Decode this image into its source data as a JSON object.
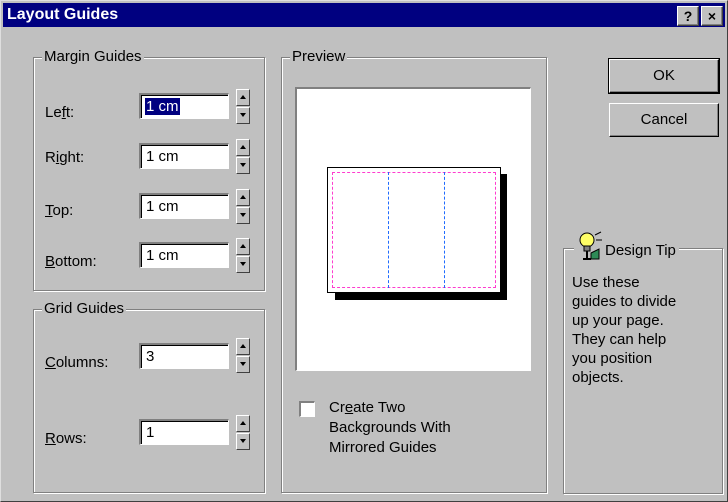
{
  "window": {
    "title": "Layout Guides",
    "help_label": "?",
    "close_label": "×"
  },
  "margin_guides": {
    "title": "Margin Guides",
    "left": {
      "label_pre": "Le",
      "label_u": "f",
      "label_post": "t:",
      "value": "1 cm"
    },
    "right": {
      "label_pre": "R",
      "label_u": "i",
      "label_post": "ght:",
      "value": "1 cm"
    },
    "top": {
      "label_pre": "",
      "label_u": "T",
      "label_post": "op:",
      "value": "1 cm"
    },
    "bottom": {
      "label_pre": "",
      "label_u": "B",
      "label_post": "ottom:",
      "value": "1 cm"
    }
  },
  "grid_guides": {
    "title": "Grid Guides",
    "columns": {
      "label_pre": "",
      "label_u": "C",
      "label_post": "olumns:",
      "value": "3"
    },
    "rows": {
      "label_pre": "",
      "label_u": "R",
      "label_post": "ows:",
      "value": "1"
    }
  },
  "preview": {
    "title": "Preview",
    "checkbox": {
      "checked": false,
      "label_line1_pre": "Cr",
      "label_line1_u": "e",
      "label_line1_post": "ate Two",
      "label_line2": "Backgrounds With",
      "label_line3": "Mirrored Guides"
    },
    "margin_color": "#ff3ccf",
    "guide_color": "#1f6bff"
  },
  "buttons": {
    "ok": "OK",
    "cancel": "Cancel"
  },
  "design_tip": {
    "title": "Design Tip",
    "icon": "light-bulb-icon",
    "text_lines": [
      "Use these",
      "guides to divide",
      "up your page.",
      "They can help",
      "you position",
      "objects."
    ]
  },
  "colors": {
    "title_bar": "#000080",
    "face": "#c0c0c0",
    "selection": "#000080"
  }
}
